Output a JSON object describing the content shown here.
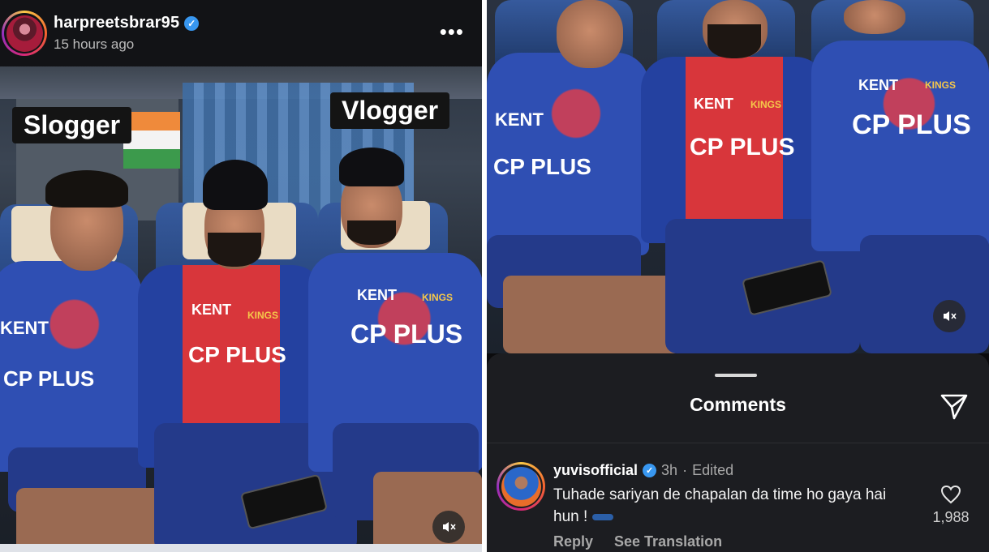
{
  "post": {
    "username": "harpreetsbrar95",
    "time": "15 hours ago",
    "more_label": "•••",
    "tags": {
      "left": "Slogger",
      "right": "Vlogger"
    }
  },
  "jersey": {
    "sponsor": "CP PLUS",
    "sponsor_alt": "KENT",
    "team": "KINGS"
  },
  "comments_sheet": {
    "title": "Comments",
    "comment": {
      "username": "yuvisofficial",
      "time": "3h",
      "separator": "·",
      "edited": "Edited",
      "text": "Tuhade sariyan de chapalan da time ho gaya hai hun !",
      "like_count": "1,988",
      "reply_label": "Reply",
      "translate_label": "See Translation"
    }
  },
  "colors": {
    "verified": "#3897f0",
    "sheet_bg": "#1c1d21",
    "jersey_blue": "#2f4fb3",
    "jersey_red": "#d8363b"
  },
  "icons": [
    "verified-icon",
    "more-icon",
    "mute-icon",
    "share-icon",
    "heart-icon"
  ]
}
